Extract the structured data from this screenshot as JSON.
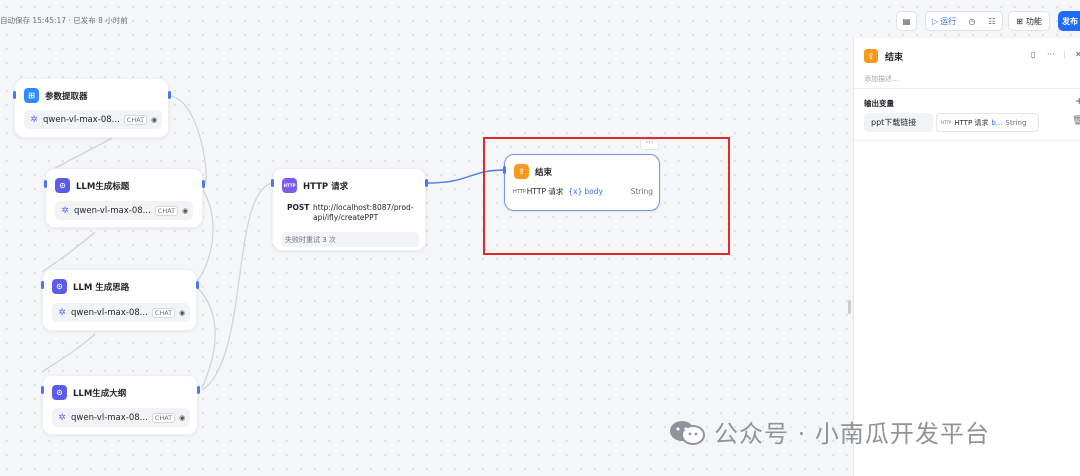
{
  "status_text": "自动保存 15:45:17 · 已发布 8 小时前",
  "toolbar": {
    "run_label": "运行",
    "features_label": "功能",
    "publish_label": "发布"
  },
  "nodes": {
    "param_extractor": {
      "title": "参数提取器",
      "model": "qwen-vl-max-08...",
      "tag": "CHAT"
    },
    "llm_title": {
      "title": "LLM生成标题",
      "model": "qwen-vl-max-08...",
      "tag": "CHAT"
    },
    "llm_idea": {
      "title": "LLM 生成思路",
      "model": "qwen-vl-max-08...",
      "tag": "CHAT"
    },
    "llm_outline": {
      "title": "LLM生成大纲",
      "model": "qwen-vl-max-08...",
      "tag": "CHAT"
    },
    "http": {
      "title": "HTTP 请求",
      "method": "POST",
      "url": "http://localhost:8087/prod-api/ifly/createPPT",
      "retry": "失败时重试 3 次",
      "icon": "HTTP"
    },
    "end": {
      "title": "结束",
      "var_source": "HTTP 请求",
      "var_prefix": "{x}",
      "var_name": "body",
      "var_type": "String",
      "more": "···"
    }
  },
  "panel": {
    "title": "结束",
    "description_placeholder": "添加描述...",
    "section_title": "输出变量",
    "var_name": "ppt下载链接",
    "var_source": "HTTP 请求",
    "var_short": "b...",
    "var_type": "String"
  },
  "watermark": "公众号 · 小南瓜开发平台",
  "colors": {
    "accent": "#1f6bff",
    "highlight": "#e5262a",
    "end_icon": "#f79a1e",
    "llm_icon": "#5b5bf0",
    "param_icon": "#2f8cff"
  }
}
